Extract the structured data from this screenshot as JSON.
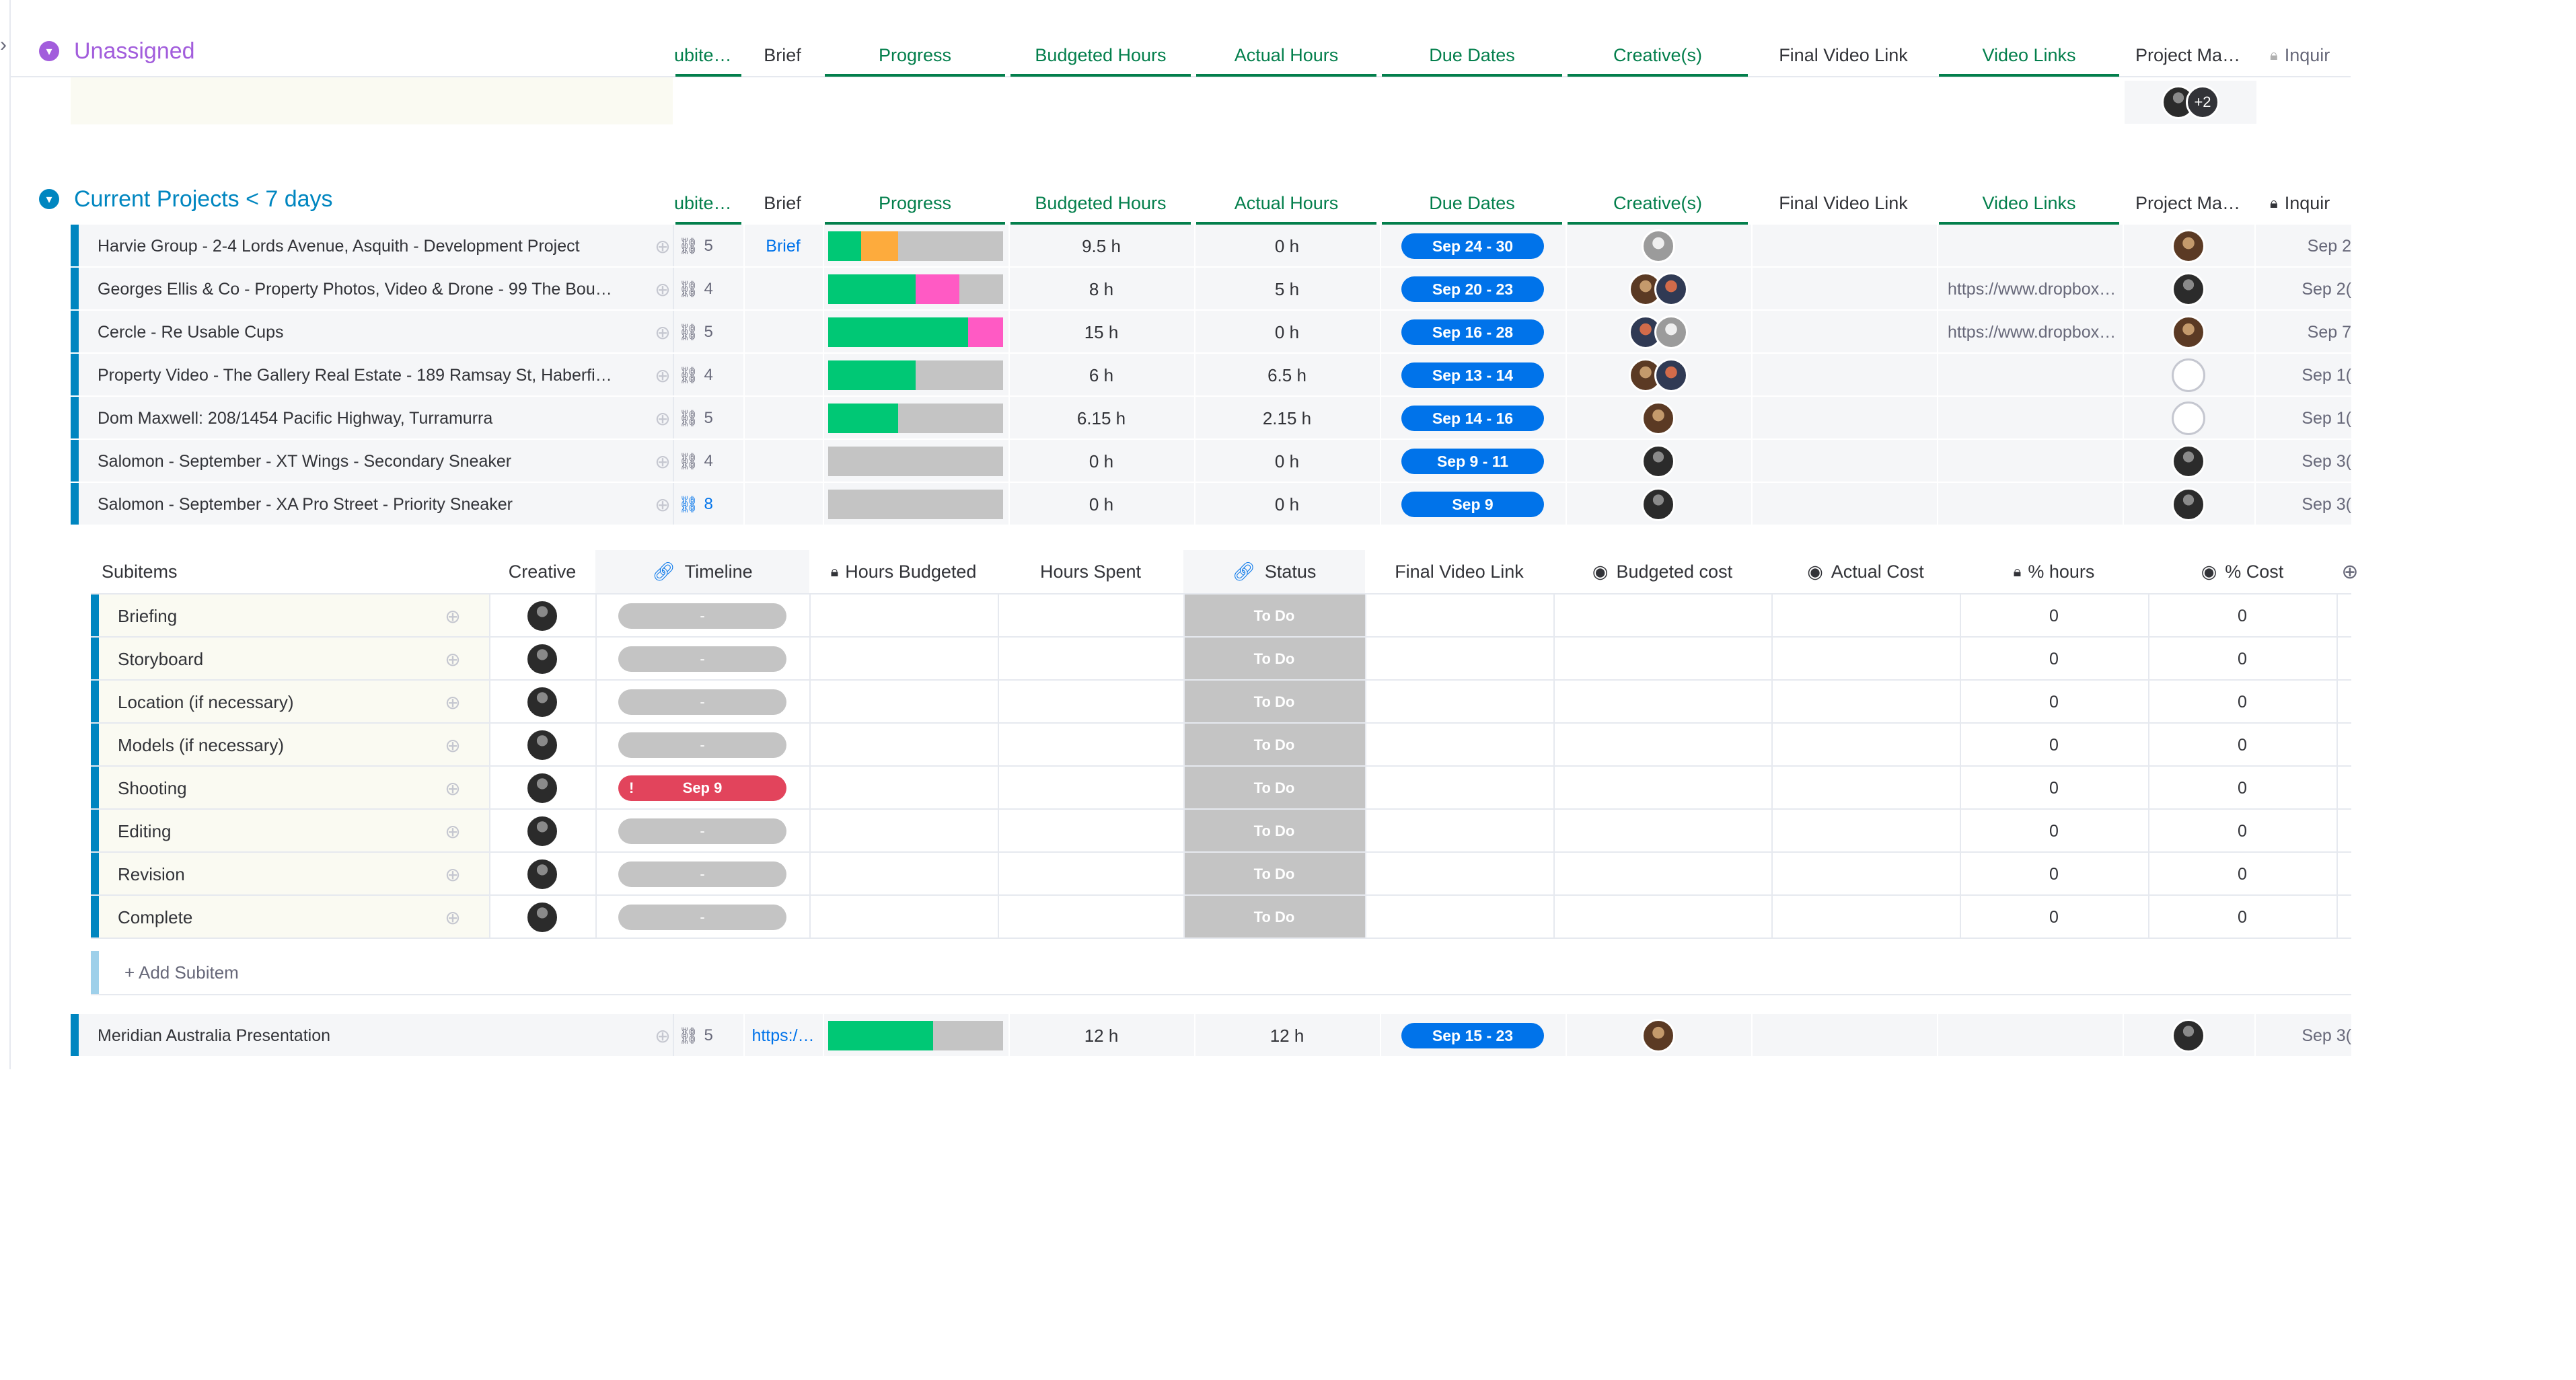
{
  "colors": {
    "accent": "#0086c0",
    "date_pill": "#0073ea",
    "green": "#00c875",
    "orange": "#fdab3d",
    "pink": "#ff5ac4",
    "grey": "#c4c4c4",
    "red": "#e2445c",
    "header_green": "#037f4c",
    "purple": "#a25ddc"
  },
  "groups": {
    "unassigned": {
      "title": "Unassigned",
      "pm_extra": "+2"
    },
    "current": {
      "title": "Current Projects < 7 days"
    }
  },
  "columns": {
    "subitems": "ubite…",
    "brief": "Brief",
    "progress": "Progress",
    "budgeted": "Budgeted Hours",
    "actual": "Actual Hours",
    "due": "Due Dates",
    "creatives": "Creative(s)",
    "final_video": "Final Video Link",
    "video_links": "Video Links",
    "pm": "Project Ma…",
    "inquiry": "Inquir"
  },
  "rows": [
    {
      "name": "Harvie Group - 2-4 Lords Avenue, Asquith - Development Project",
      "subitems": "5",
      "brief": "Brief",
      "budgeted": "9.5 h",
      "actual": "0 h",
      "due": "Sep 24 - 30",
      "video": "",
      "inquiry": "Sep 2",
      "progress": [
        {
          "c": "green",
          "v": 0.19
        },
        {
          "c": "orange",
          "v": 0.21
        }
      ]
    },
    {
      "name": "Georges Ellis & Co - Property Photos, Video & Drone - 99 The Bou…",
      "subitems": "4",
      "brief": "",
      "budgeted": "8 h",
      "actual": "5 h",
      "due": "Sep 20 - 23",
      "video": "https://www.dropbox…",
      "inquiry": "Sep 2(",
      "progress": [
        {
          "c": "green",
          "v": 0.5
        },
        {
          "c": "pink",
          "v": 0.25
        }
      ]
    },
    {
      "name": "Cercle - Re Usable Cups",
      "subitems": "5",
      "brief": "",
      "budgeted": "15 h",
      "actual": "0 h",
      "due": "Sep 16 - 28",
      "video": "https://www.dropbox…",
      "inquiry": "Sep 7",
      "progress": [
        {
          "c": "green",
          "v": 0.8
        },
        {
          "c": "pink",
          "v": 0.2
        }
      ]
    },
    {
      "name": "Property Video - The Gallery Real Estate - 189 Ramsay St, Haberfi…",
      "subitems": "4",
      "brief": "",
      "budgeted": "6 h",
      "actual": "6.5 h",
      "due": "Sep 13 - 14",
      "video": "",
      "inquiry": "Sep 1(",
      "progress": [
        {
          "c": "green",
          "v": 0.5
        }
      ]
    },
    {
      "name": "Dom Maxwell: 208/1454 Pacific Highway, Turramurra",
      "subitems": "5",
      "brief": "",
      "budgeted": "6.15 h",
      "actual": "2.15 h",
      "due": "Sep 14 - 16",
      "video": "",
      "inquiry": "Sep 1(",
      "progress": [
        {
          "c": "green",
          "v": 0.4
        }
      ]
    },
    {
      "name": "Salomon - September - XT Wings - Secondary Sneaker",
      "subitems": "4",
      "brief": "",
      "budgeted": "0 h",
      "actual": "0 h",
      "due": "Sep 9 - 11",
      "video": "",
      "inquiry": "Sep 3(",
      "progress": []
    },
    {
      "name": "Salomon - September - XA Pro Street - Priority Sneaker",
      "subitems": "8",
      "brief": "",
      "budgeted": "0 h",
      "actual": "0 h",
      "due": "Sep 9",
      "video": "",
      "inquiry": "Sep 3(",
      "progress": []
    }
  ],
  "sub_columns": {
    "subitems": "Subitems",
    "creative": "Creative",
    "timeline": "Timeline",
    "hours_budgeted": "Hours Budgeted",
    "hours_spent": "Hours Spent",
    "status": "Status",
    "final_video": "Final Video Link",
    "budgeted_cost": "Budgeted cost",
    "actual_cost": "Actual Cost",
    "pct_hours": "% hours",
    "pct_cost": "% Cost"
  },
  "subitems": [
    {
      "name": "Briefing",
      "timeline": "-",
      "status": "To Do",
      "pct_hours": "0",
      "pct_cost": "0"
    },
    {
      "name": "Storyboard",
      "timeline": "-",
      "status": "To Do",
      "pct_hours": "0",
      "pct_cost": "0"
    },
    {
      "name": "Location (if necessary)",
      "timeline": "-",
      "status": "To Do",
      "pct_hours": "0",
      "pct_cost": "0"
    },
    {
      "name": "Models (if necessary)",
      "timeline": "-",
      "status": "To Do",
      "pct_hours": "0",
      "pct_cost": "0"
    },
    {
      "name": "Shooting",
      "timeline": "Sep 9",
      "status": "To Do",
      "pct_hours": "0",
      "pct_cost": "0",
      "overdue": true
    },
    {
      "name": "Editing",
      "timeline": "-",
      "status": "To Do",
      "pct_hours": "0",
      "pct_cost": "0"
    },
    {
      "name": "Revision",
      "timeline": "-",
      "status": "To Do",
      "pct_hours": "0",
      "pct_cost": "0"
    },
    {
      "name": "Complete",
      "timeline": "-",
      "status": "To Do",
      "pct_hours": "0",
      "pct_cost": "0"
    }
  ],
  "add_subitem": "+ Add Subitem",
  "last_row": {
    "name": "Meridian Australia Presentation",
    "subitems": "5",
    "brief": "https:/…",
    "budgeted": "12 h",
    "actual": "12 h",
    "due": "Sep 15 - 23",
    "inquiry": "Sep 3(",
    "progress": [
      {
        "c": "green",
        "v": 0.6
      }
    ]
  }
}
